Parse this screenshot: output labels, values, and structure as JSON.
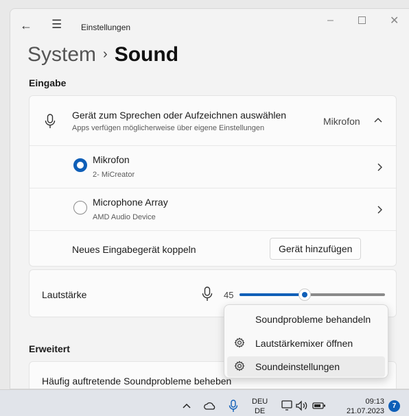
{
  "window": {
    "title": "Einstellungen"
  },
  "breadcrumb": {
    "parent": "System",
    "current": "Sound"
  },
  "input": {
    "heading": "Eingabe",
    "select_device": {
      "title": "Gerät zum Sprechen oder Aufzeichnen auswählen",
      "subtitle": "Apps verfügen möglicherweise über eigene Einstellungen",
      "value": "Mikrofon"
    },
    "devices": [
      {
        "name": "Mikrofon",
        "detail": "2- MiCreator",
        "selected": true
      },
      {
        "name": "Microphone Array",
        "detail": "AMD Audio Device",
        "selected": false
      }
    ],
    "pair": {
      "label": "Neues Eingabegerät koppeln",
      "button": "Gerät hinzufügen"
    },
    "volume": {
      "label": "Lautstärke",
      "value": "45",
      "percent": 45
    }
  },
  "advanced": {
    "heading": "Erweitert",
    "row": "Häufig auftretende Soundprobleme beheben"
  },
  "context_menu": {
    "items": [
      {
        "label": "Soundprobleme behandeln",
        "icon": ""
      },
      {
        "label": "Lautstärkemixer öffnen",
        "icon": "gear-icon"
      },
      {
        "label": "Soundeinstellungen",
        "icon": "gear-icon"
      }
    ]
  },
  "taskbar": {
    "lang_top": "DEU",
    "lang_bottom": "DE",
    "time": "09:13",
    "date": "21.07.2023",
    "notifications": "7"
  },
  "colors": {
    "accent": "#0f5fb8"
  }
}
